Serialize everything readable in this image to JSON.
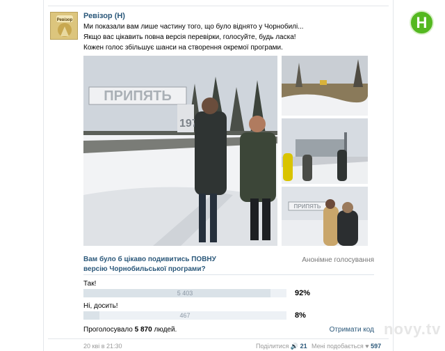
{
  "post": {
    "author": "Ревізор (Н)",
    "avatar_text": "Ревізор",
    "lines": [
      "Ми показали вам лише частину того, що було віднято у Чорнобилі...",
      "Якщо вас цікавить повна версія перевірки, голосуйте, будь ласка!",
      "Кожен голос збільшує шанси на створення окремої програми."
    ],
    "photo_main_sign": "ПРИПЯТЬ",
    "photo_main_year": "197",
    "photo_small_sign": "ПРИПЯТЬ"
  },
  "poll": {
    "question": "Вам було б цікаво подивитись ПОВНУ версію Чорнобильської програми?",
    "type_label": "Анонімне голосування",
    "options": [
      {
        "label": "Так!",
        "votes": "5 403",
        "percent": "92%",
        "share": 0.92
      },
      {
        "label": "Ні, досить!",
        "votes": "467",
        "percent": "8%",
        "share": 0.08
      }
    ],
    "voted_prefix": "Проголосувало ",
    "voted_count": "5 870",
    "voted_suffix": " людей.",
    "get_code": "Отримати код"
  },
  "footer": {
    "date": "20 квi в 21:30",
    "share_label": "Поділитися",
    "share_count": "21",
    "like_label": "Мені подобається",
    "like_count": "597"
  },
  "brand": {
    "logo_letter": "Н",
    "watermark": "novy.tv",
    "accent": "#2b587a",
    "logo_color": "#54b820"
  }
}
